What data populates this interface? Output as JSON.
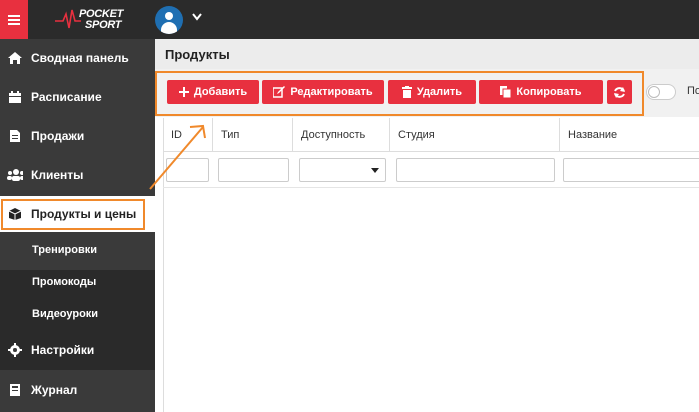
{
  "header": {
    "logo_text_1": "POCKET",
    "logo_text_2": "SPORT"
  },
  "sidebar": {
    "items": [
      {
        "label": "Сводная панель",
        "icon": "home-icon"
      },
      {
        "label": "Расписание",
        "icon": "calendar-icon"
      },
      {
        "label": "Продажи",
        "icon": "document-icon"
      },
      {
        "label": "Клиенты",
        "icon": "users-icon"
      },
      {
        "label": "Продукты и цены",
        "icon": "box-icon"
      },
      {
        "label": "Настройки",
        "icon": "gear-icon"
      },
      {
        "label": "Журнал",
        "icon": "journal-icon"
      }
    ],
    "subitems": [
      "Тренировки",
      "Промокоды",
      "Видеоуроки"
    ]
  },
  "page": {
    "title": "Продукты"
  },
  "toolbar": {
    "add_label": "Добавить",
    "edit_label": "Редактировать",
    "delete_label": "Удалить",
    "copy_label": "Копировать",
    "toggle_label": "По"
  },
  "table": {
    "columns": [
      "ID",
      "Тип",
      "Доступность",
      "Студия",
      "Название"
    ]
  },
  "colors": {
    "accent": "#e8303f",
    "highlight": "#f0892b",
    "sidebar": "#3a3a3a",
    "topbar": "#2b2b2b"
  }
}
